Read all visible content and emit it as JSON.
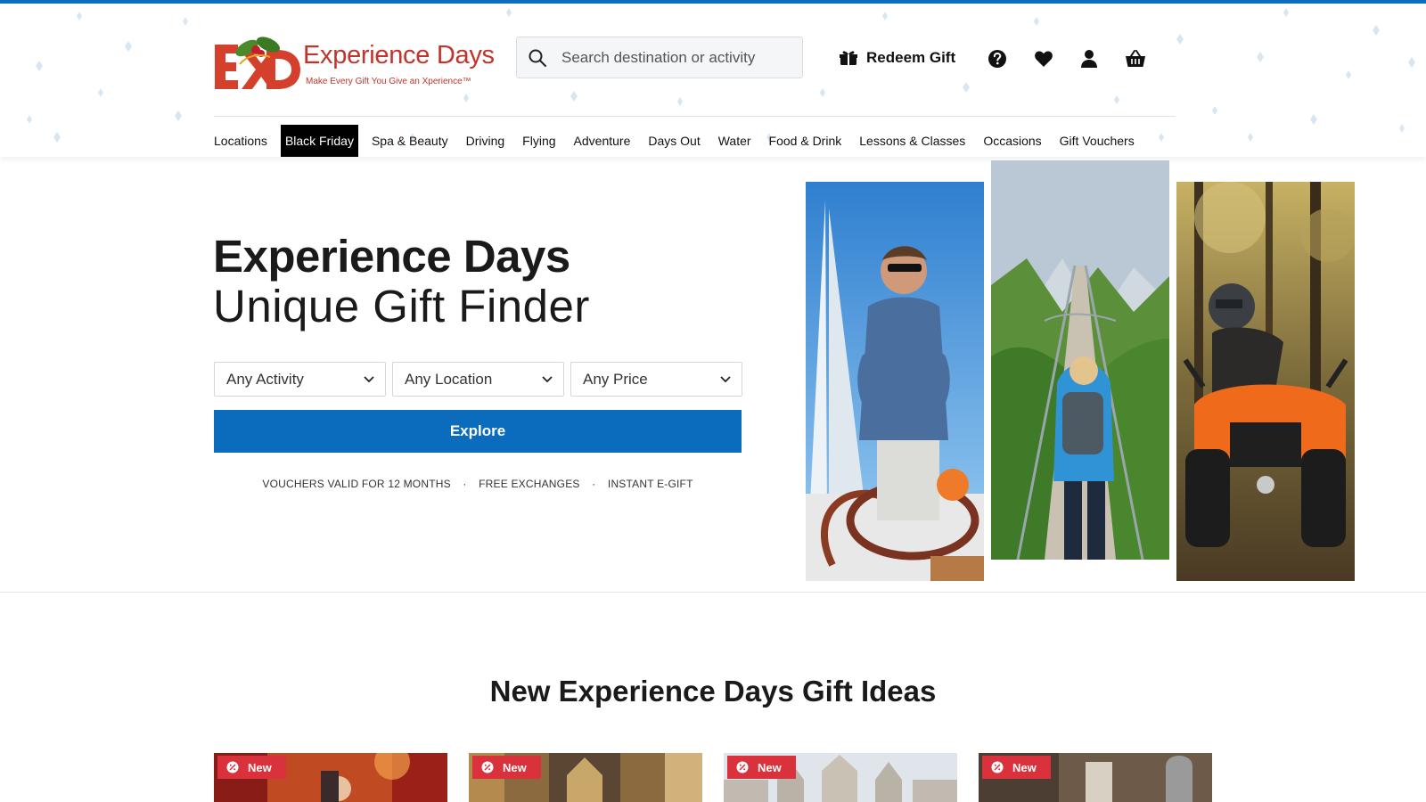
{
  "brand": {
    "name": "Experience Days",
    "tagline": "Make Every Gift You Give an Xperience™",
    "primary_color": "#0b6cbe",
    "logo_color": "#c2342b"
  },
  "header": {
    "search_placeholder": "Search destination or activity",
    "redeem_label": "Redeem Gift",
    "icons": [
      "gift-box-icon",
      "help-icon",
      "heart-icon",
      "user-icon",
      "basket-icon"
    ]
  },
  "nav": {
    "items": [
      {
        "label": "Locations"
      },
      {
        "label": "Black Friday",
        "active": true
      },
      {
        "label": "Spa & Beauty"
      },
      {
        "label": "Driving"
      },
      {
        "label": "Flying"
      },
      {
        "label": "Adventure"
      },
      {
        "label": "Days Out"
      },
      {
        "label": "Water"
      },
      {
        "label": "Food & Drink"
      },
      {
        "label": "Lessons & Classes"
      },
      {
        "label": "Occasions"
      },
      {
        "label": "Gift Vouchers"
      }
    ]
  },
  "hero": {
    "title": "Experience Days",
    "subtitle": "Unique Gift Finder",
    "filters": [
      {
        "label": "Any Activity"
      },
      {
        "label": "Any Location"
      },
      {
        "label": "Any Price"
      }
    ],
    "explore_label": "Explore",
    "perks": [
      "VOUCHERS VALID FOR 12 MONTHS",
      "FREE EXCHANGES",
      "INSTANT E-GIFT"
    ],
    "perk_separator": "·",
    "images": [
      "sailing-photo",
      "mountain-bridge-photo",
      "quad-bike-photo"
    ]
  },
  "gift_ideas": {
    "title": "New Experience Days Gift Ideas",
    "badge_label": "New",
    "cards": [
      {
        "image": "theatre-show-photo"
      },
      {
        "image": "cathedral-interior-photo"
      },
      {
        "image": "gothic-building-photo"
      },
      {
        "image": "historic-house-photo"
      }
    ]
  }
}
